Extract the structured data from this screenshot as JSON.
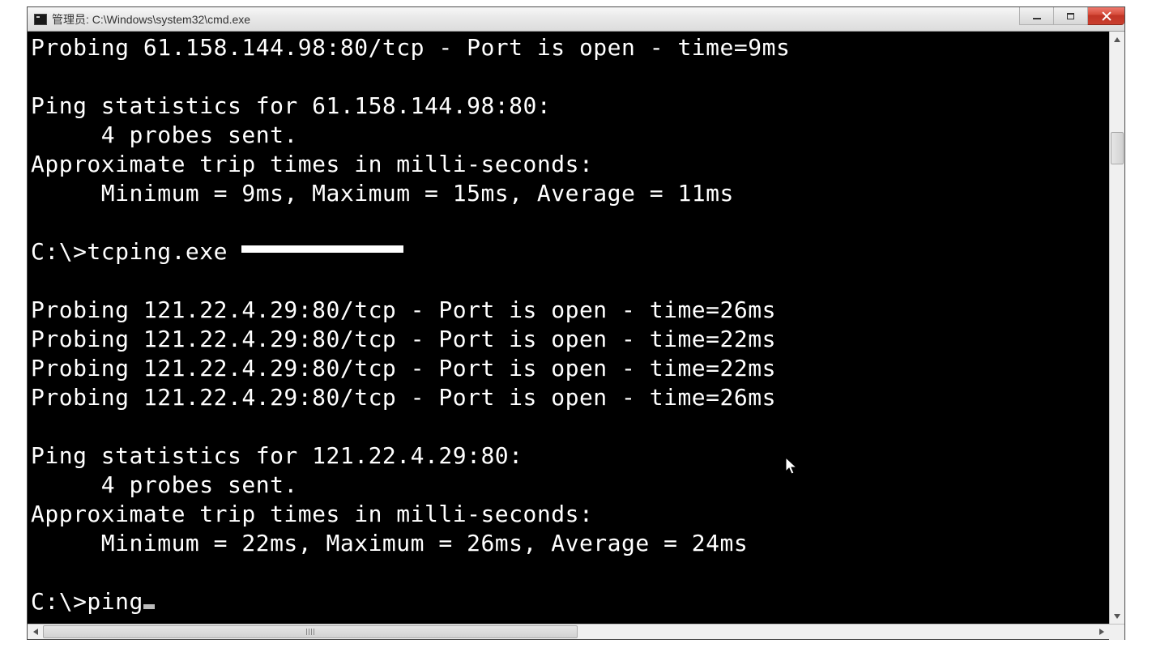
{
  "window": {
    "title": "管理员: C:\\Windows\\system32\\cmd.exe"
  },
  "output": {
    "line1": "Probing 61.158.144.98:80/tcp - Port is open - time=9ms",
    "blank1": "",
    "stats1_header": "Ping statistics for 61.158.144.98:80:",
    "stats1_probes": "     4 probes sent.",
    "stats1_approx": "Approximate trip times in milli-seconds:",
    "stats1_values": "     Minimum = 9ms, Maximum = 15ms, Average = 11ms",
    "blank2": "",
    "cmd1_prefix": "C:\\>tcping.exe ",
    "blank3": "",
    "probe2a": "Probing 121.22.4.29:80/tcp - Port is open - time=26ms",
    "probe2b": "Probing 121.22.4.29:80/tcp - Port is open - time=22ms",
    "probe2c": "Probing 121.22.4.29:80/tcp - Port is open - time=22ms",
    "probe2d": "Probing 121.22.4.29:80/tcp - Port is open - time=26ms",
    "blank4": "",
    "stats2_header": "Ping statistics for 121.22.4.29:80:",
    "stats2_probes": "     4 probes sent.",
    "stats2_approx": "Approximate trip times in milli-seconds:",
    "stats2_values": "     Minimum = 22ms, Maximum = 26ms, Average = 24ms",
    "blank5": "",
    "prompt_prefix": "C:\\>ping"
  }
}
